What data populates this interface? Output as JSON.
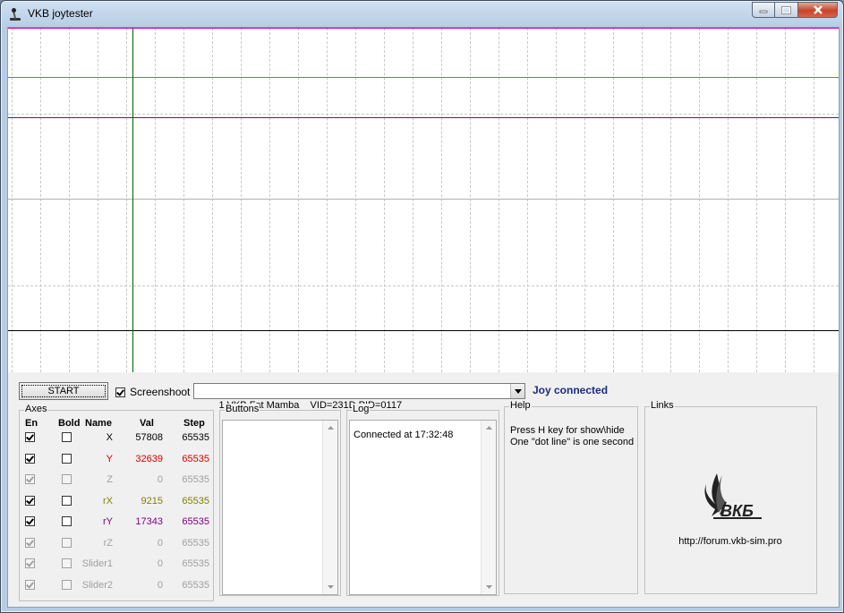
{
  "window": {
    "title": "VKB joytester",
    "icon": "joystick-icon",
    "controls": [
      "minimize-icon",
      "maximize-icon",
      "close-icon"
    ]
  },
  "toolbar": {
    "start_label": "START",
    "screenshot_label": "Screenshoot",
    "screenshot_checked": true,
    "device": "1 VKB Fat Mamba    VID=231D PID=0117",
    "status": "Joy connected",
    "status_color": "#1a2b80"
  },
  "axes": {
    "title": "Axes",
    "headers": {
      "en": "En",
      "bold": "Bold",
      "name": "Name",
      "val": "Val",
      "step": "Step"
    },
    "rows": [
      {
        "name": "X",
        "val": "57808",
        "step": "65535",
        "enabled": true,
        "bold": false,
        "active": true,
        "color": "#000000"
      },
      {
        "name": "Y",
        "val": "32639",
        "step": "65535",
        "enabled": true,
        "bold": false,
        "active": true,
        "color": "#d40000"
      },
      {
        "name": "Z",
        "val": "0",
        "step": "65535",
        "enabled": true,
        "bold": false,
        "active": false,
        "color": "#a0a0a0"
      },
      {
        "name": "rX",
        "val": "9215",
        "step": "65535",
        "enabled": true,
        "bold": false,
        "active": true,
        "color": "#808000"
      },
      {
        "name": "rY",
        "val": "17343",
        "step": "65535",
        "enabled": true,
        "bold": false,
        "active": true,
        "color": "#800080"
      },
      {
        "name": "rZ",
        "val": "0",
        "step": "65535",
        "enabled": true,
        "bold": false,
        "active": false,
        "color": "#a0a0a0"
      },
      {
        "name": "Slider1",
        "val": "0",
        "step": "65535",
        "enabled": true,
        "bold": false,
        "active": false,
        "color": "#a0a0a0"
      },
      {
        "name": "Slider2",
        "val": "0",
        "step": "65535",
        "enabled": true,
        "bold": false,
        "active": false,
        "color": "#a0a0a0"
      }
    ]
  },
  "buttons_panel": {
    "title": "Buttons"
  },
  "log": {
    "title": "Log",
    "lines": [
      "Connected at 17:32:48"
    ]
  },
  "help": {
    "title": "Help",
    "line1": "Press H key for show\\hide",
    "line2": "One \"dot line\" is one second"
  },
  "links": {
    "title": "Links",
    "logo": "vkb-logo",
    "logo_text": "ВКБ",
    "url": "http://forum.vkb-sim.pro"
  },
  "plot": {
    "colors": {
      "x": "#000000",
      "y": "#c000c0",
      "rx": "#6b8e23",
      "ry": "#8b008b",
      "cursor": "#006400",
      "grid": "#c8c8c8"
    }
  }
}
